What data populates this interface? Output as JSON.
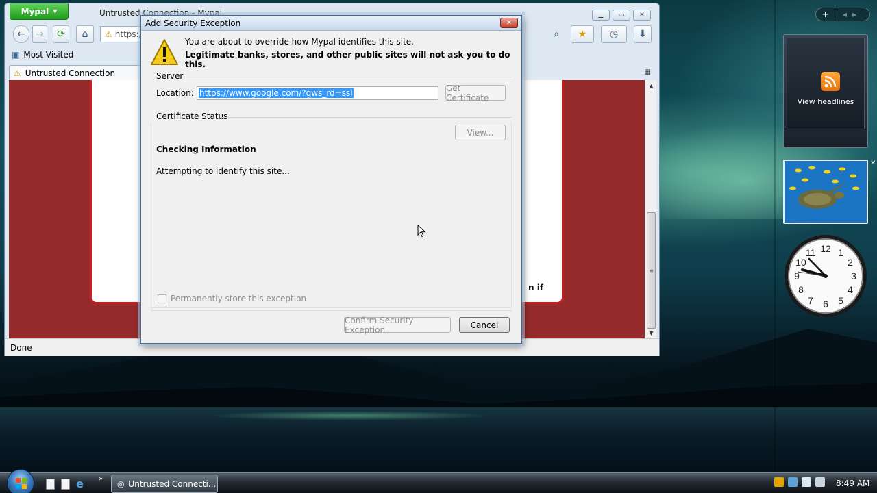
{
  "browser": {
    "app_menu_label": "Mypal",
    "window_title": "Untrusted Connection - Mypal",
    "url_partial": "https:/",
    "bookmarks": [
      "Most Visited"
    ],
    "tab_title": "Untrusted Connection",
    "partial_page_text": "n if",
    "status": "Done"
  },
  "dialog": {
    "title": "Add Security Exception",
    "message_line1": "You are about to override how Mypal identifies this site.",
    "message_line2": "Legitimate banks, stores, and other public sites will not ask you to do this.",
    "server_group": "Server",
    "location_label": "Location:",
    "location_value": "https://www.google.com/?gws_rd=ssl",
    "get_certificate": "Get Certificate",
    "cert_status_group": "Certificate Status",
    "view_button": "View...",
    "checking_title": "Checking Information",
    "checking_message": "Attempting to identify this site...",
    "permanent_checkbox": "Permanently store this exception",
    "confirm_button": "Confirm Security Exception",
    "cancel_button": "Cancel"
  },
  "sidebar": {
    "feed_label": "View headlines"
  },
  "taskbar": {
    "task_label": "Untrusted Connecti...",
    "time": "8:49 AM"
  },
  "colors": {
    "page_background": "#952a2a",
    "card_border": "#c81e1e",
    "mypal_green": "#2aa826",
    "selection": "#3399ff"
  },
  "icons": [
    "warning-icon",
    "back-icon",
    "forward-icon",
    "reload-icon",
    "home-icon",
    "search-icon",
    "bookmark-star-icon",
    "history-icon",
    "download-icon",
    "rss-icon",
    "windows-orb-icon",
    "ie-icon",
    "shield-icon",
    "network-icon",
    "volume-muted-icon"
  ]
}
